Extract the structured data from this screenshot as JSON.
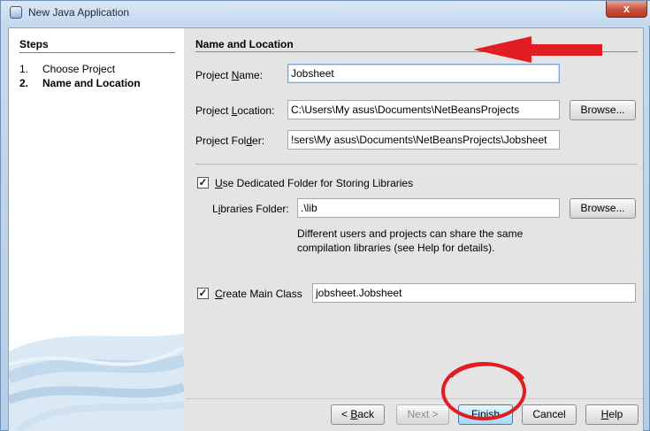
{
  "window": {
    "title": "New Java Application",
    "close_glyph": "x"
  },
  "steps": {
    "title": "Steps",
    "items": [
      {
        "num": "1.",
        "label": "Choose Project"
      },
      {
        "num": "2.",
        "label": "Name and Location"
      }
    ]
  },
  "main": {
    "title": "Name and Location",
    "project_name": {
      "label_pre": "Project ",
      "label_u": "N",
      "label_post": "ame:",
      "value": "Jobsheet"
    },
    "project_location": {
      "label_pre": "Project ",
      "label_u": "L",
      "label_post": "ocation:",
      "value": "C:\\Users\\My asus\\Documents\\NetBeansProjects",
      "browse": "Browse..."
    },
    "project_folder": {
      "label_pre": "Project Fol",
      "label_u": "d",
      "label_post": "er:",
      "value": "!sers\\My asus\\Documents\\NetBeansProjects\\Jobsheet"
    },
    "dedicated_folder": {
      "label_pre": "",
      "label_u": "U",
      "label_post": "se Dedicated Folder for Storing Libraries",
      "checked": true,
      "check_glyph": "✓"
    },
    "libraries_folder": {
      "label_pre": "L",
      "label_u": "i",
      "label_post": "braries Folder:",
      "value": ".\\lib",
      "browse": "Browse..."
    },
    "note_line1": "Different users and projects can share the same",
    "note_line2": "compilation libraries (see Help for details).",
    "main_class": {
      "label_pre": "",
      "label_u": "C",
      "label_post": "reate Main Class",
      "checked": true,
      "check_glyph": "✓",
      "value": "jobsheet.Jobsheet"
    }
  },
  "buttons": {
    "back": {
      "pre": "< ",
      "u": "B",
      "post": "ack"
    },
    "next": {
      "label": "Next >"
    },
    "finish": {
      "pre": "",
      "u": "F",
      "post": "inish"
    },
    "cancel": {
      "label": "Cancel"
    },
    "help": {
      "pre": "",
      "u": "H",
      "post": "elp"
    }
  },
  "colors": {
    "annotation_red": "#e11d24",
    "accent_blue": "#3c7fb1"
  },
  "icons": {
    "app": "java-app-icon",
    "close": "close-icon",
    "checkbox": "checkmark-icon"
  }
}
